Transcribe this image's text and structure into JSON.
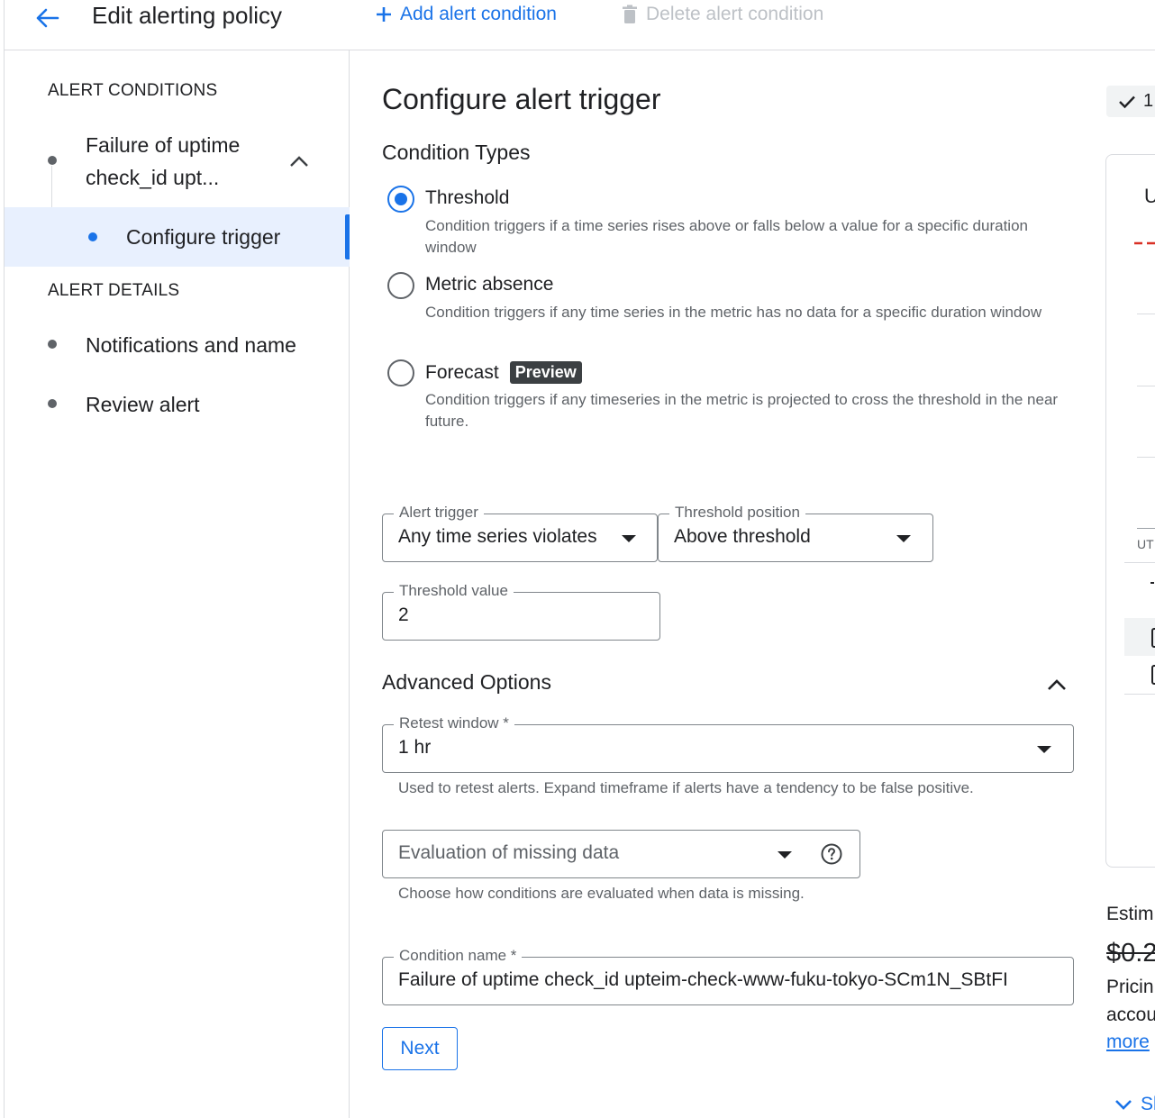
{
  "header": {
    "title": "Edit alerting policy",
    "add_condition": "Add alert condition",
    "delete_condition": "Delete alert condition"
  },
  "sidebar": {
    "alert_conditions_heading": "ALERT CONDITIONS",
    "condition_line1": "Failure of uptime",
    "condition_line2": "check_id upt...",
    "configure_trigger": "Configure trigger",
    "alert_details_heading": "ALERT DETAILS",
    "notifications": "Notifications and name",
    "review": "Review alert"
  },
  "main": {
    "title": "Configure alert trigger",
    "condition_types_heading": "Condition Types",
    "condition_types": [
      {
        "label": "Threshold",
        "selected": true,
        "desc": "Condition triggers if a time series rises above or falls below a value for a specific duration window"
      },
      {
        "label": "Metric absence",
        "selected": false,
        "desc": "Condition triggers if any time series in the metric has no data for a specific duration window"
      },
      {
        "label": "Forecast",
        "badge": "Preview",
        "selected": false,
        "desc": "Condition triggers if any timeseries in the metric is projected to cross the threshold in the near future."
      }
    ],
    "alert_trigger": {
      "label": "Alert trigger",
      "value": "Any time series violates"
    },
    "threshold_position": {
      "label": "Threshold position",
      "value": "Above threshold"
    },
    "threshold_value": {
      "label": "Threshold value",
      "value": "2"
    },
    "advanced_heading": "Advanced Options",
    "retest_window": {
      "label": "Retest window *",
      "value": "1 hr",
      "hint": "Used to retest alerts. Expand timeframe if alerts have a tendency to be false positive."
    },
    "missing_data": {
      "placeholder": "Evaluation of missing data",
      "hint": "Choose how conditions are evaluated when data is missing."
    },
    "condition_name": {
      "label": "Condition name *",
      "value": "Failure of uptime check_id upteim-check-www-fuku-tokyo-SCm1N_SBtFI"
    },
    "next": "Next"
  },
  "right_panel": {
    "toggle_partial": "1",
    "card_title_partial": "U",
    "axis_partial": "UT",
    "estimate_partial": "Estim",
    "price_partial": "$0.2",
    "pricing_partial": "Pricin",
    "account_partial": "accou",
    "more_link_partial": "more",
    "show_partial": "Sl"
  },
  "colors": {
    "accent": "#1a73e8",
    "text": "#202124",
    "secondary_text": "#5f6368",
    "selected_row": "#e8f0fe",
    "threshold_line": "#d93025"
  }
}
